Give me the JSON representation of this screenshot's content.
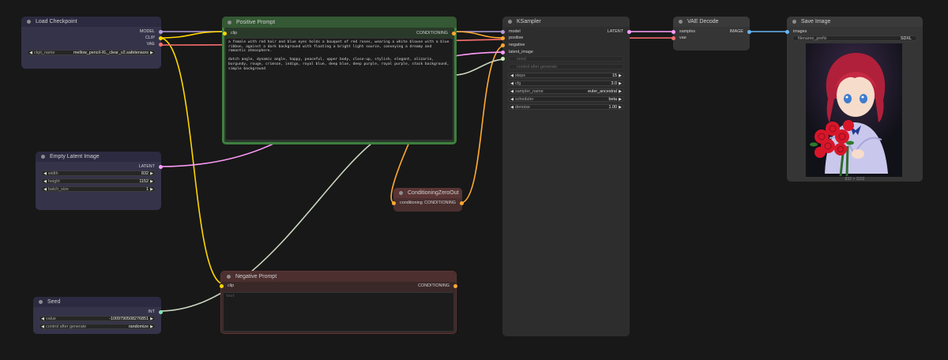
{
  "colors": {
    "canvas": "#181818",
    "model": "#b39ddb",
    "clip": "#ffd500",
    "vae": "#ff6e6e",
    "conditioning": "#ffa931",
    "latent": "#ff9cf9",
    "image": "#64b5f6",
    "int": "#7de3b5"
  },
  "nodes": {
    "load_checkpoint": {
      "title": "Load Checkpoint",
      "outputs": [
        "MODEL",
        "CLIP",
        "VAE"
      ],
      "ckpt_label": "ckpt_name",
      "ckpt_value": "mellow_pencil-XL_clear_v2.safetensors"
    },
    "positive_prompt": {
      "title": "Positive Prompt",
      "input": "clip",
      "output": "CONDITIONING",
      "text": "a female with red hair and blue eyes holds a bouquet of red roses, wearing a white blouse with a blue ribbon, against a dark background with floating a bright light source, conveying a dreamy and romantic atmosphere.\n\ndutch angle, dynamic angle, happy, peaceful, upper body, close-up, stylish, elegant, alizarin, burgundy, rouge, crimson, indigo, royal blue, deep blue, deep purple, royal purple, stack background, simple background"
    },
    "ksampler": {
      "title": "KSampler",
      "inputs": [
        "model",
        "positive",
        "negative",
        "latent_image"
      ],
      "output": "LATENT",
      "seed_label": "seed",
      "control_label": "control after generate",
      "widgets": [
        {
          "label": "steps",
          "value": "15"
        },
        {
          "label": "cfg",
          "value": "3.0"
        },
        {
          "label": "sampler_name",
          "value": "euler_ancestral"
        },
        {
          "label": "scheduler",
          "value": "beta"
        },
        {
          "label": "denoise",
          "value": "1.00"
        }
      ]
    },
    "vae_decode": {
      "title": "VAE Decode",
      "inputs": [
        "samples",
        "vae"
      ],
      "output": "IMAGE"
    },
    "save_image": {
      "title": "Save Image",
      "input": "images",
      "prefix_label": "filename_prefix",
      "prefix_value": "SDXL",
      "caption": "832 × 1152"
    },
    "empty_latent": {
      "title": "Empty Latent Image",
      "output": "LATENT",
      "widgets": [
        {
          "label": "width",
          "value": "832"
        },
        {
          "label": "height",
          "value": "1152"
        },
        {
          "label": "batch_size",
          "value": "1"
        }
      ]
    },
    "cond_zero_out": {
      "title": "ConditioningZeroOut",
      "input": "conditioning",
      "output": "CONDITIONING"
    },
    "negative_prompt": {
      "title": "Negative Prompt",
      "input": "clip",
      "output": "CONDITIONING",
      "placeholder": "text"
    },
    "seed": {
      "title": "Seed",
      "output": "INT",
      "widgets": [
        {
          "label": "value",
          "value": "-1009790508276851"
        },
        {
          "label": "control after generate",
          "value": "randomize"
        }
      ]
    }
  }
}
